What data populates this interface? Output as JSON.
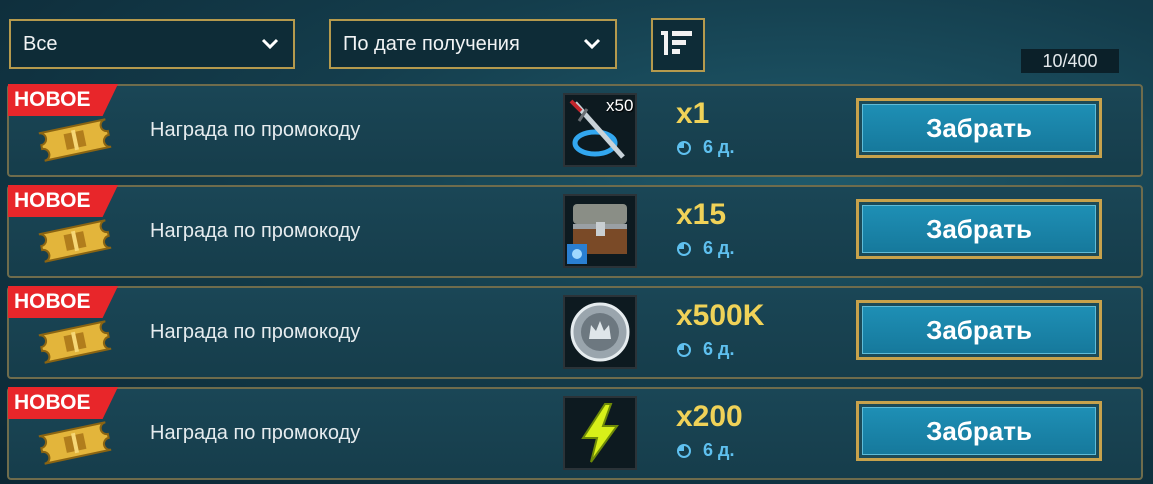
{
  "filters": {
    "category": {
      "selected": "Все"
    },
    "sort": {
      "selected": "По дате получения"
    },
    "counter": "10/400"
  },
  "rewards": [
    {
      "badge": "НОВОЕ",
      "label": "Награда по промокоду",
      "item_icon": "sword-portal-icon",
      "item_count": "x50",
      "quantity": "x1",
      "timer": "6 д.",
      "claim_label": "Забрать"
    },
    {
      "badge": "НОВОЕ",
      "label": "Награда по промокоду",
      "item_icon": "treasure-chest-icon",
      "item_count": "",
      "quantity": "x15",
      "timer": "6 д.",
      "claim_label": "Забрать"
    },
    {
      "badge": "НОВОЕ",
      "label": "Награда по промокоду",
      "item_icon": "silver-coin-icon",
      "item_count": "",
      "quantity": "x500K",
      "timer": "6 д.",
      "claim_label": "Забрать"
    },
    {
      "badge": "НОВОЕ",
      "label": "Награда по промокоду",
      "item_icon": "lightning-energy-icon",
      "item_count": "",
      "quantity": "x200",
      "timer": "6 д.",
      "claim_label": "Забрать"
    }
  ],
  "colors": {
    "accent_gold": "#f0d258",
    "badge_red": "#e8262a",
    "button_blue": "#1e8fb5",
    "timer_blue": "#5fc0ef"
  }
}
